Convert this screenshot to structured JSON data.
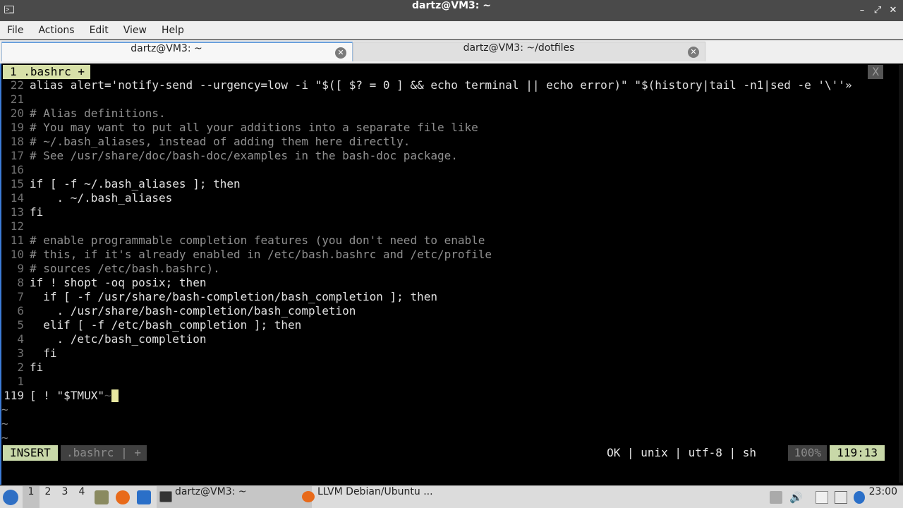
{
  "window": {
    "title": "dartz@VM3: ~"
  },
  "menu": [
    "File",
    "Actions",
    "Edit",
    "View",
    "Help"
  ],
  "tabs": [
    {
      "label": "dartz@VM3: ~",
      "active": true
    },
    {
      "label": "dartz@VM3: ~/dotfiles",
      "active": false
    }
  ],
  "vim": {
    "buffer_tab": "1 .bashrc +",
    "buffer_close": "X",
    "lines": [
      {
        "num": "22",
        "text": "alias alert='notify-send --urgency=low -i \"$([ $? = 0 ] && echo terminal || echo error)\" \"$(history|tail -n1|sed -e '\\''»",
        "kind": "code"
      },
      {
        "num": "21",
        "text": "",
        "kind": "code"
      },
      {
        "num": "20",
        "text": "# Alias definitions.",
        "kind": "comment"
      },
      {
        "num": "19",
        "text": "# You may want to put all your additions into a separate file like",
        "kind": "comment"
      },
      {
        "num": "18",
        "text": "# ~/.bash_aliases, instead of adding them here directly.",
        "kind": "comment"
      },
      {
        "num": "17",
        "text": "# See /usr/share/doc/bash-doc/examples in the bash-doc package.",
        "kind": "comment"
      },
      {
        "num": "16",
        "text": "",
        "kind": "code"
      },
      {
        "num": "15",
        "text": "if [ -f ~/.bash_aliases ]; then",
        "kind": "code"
      },
      {
        "num": "14",
        "text": "    . ~/.bash_aliases",
        "kind": "code"
      },
      {
        "num": "13",
        "text": "fi",
        "kind": "code"
      },
      {
        "num": "12",
        "text": "",
        "kind": "code"
      },
      {
        "num": "11",
        "text": "# enable programmable completion features (you don't need to enable",
        "kind": "comment"
      },
      {
        "num": "10",
        "text": "# this, if it's already enabled in /etc/bash.bashrc and /etc/profile",
        "kind": "comment"
      },
      {
        "num": "9",
        "text": "# sources /etc/bash.bashrc).",
        "kind": "comment"
      },
      {
        "num": "8",
        "text": "if ! shopt -oq posix; then",
        "kind": "code"
      },
      {
        "num": "7",
        "text": "  if [ -f /usr/share/bash-completion/bash_completion ]; then",
        "kind": "code"
      },
      {
        "num": "6",
        "text": "    . /usr/share/bash-completion/bash_completion",
        "kind": "code"
      },
      {
        "num": "5",
        "text": "  elif [ -f /etc/bash_completion ]; then",
        "kind": "code"
      },
      {
        "num": "4",
        "text": "    . /etc/bash_completion",
        "kind": "code"
      },
      {
        "num": "3",
        "text": "  fi",
        "kind": "code"
      },
      {
        "num": "2",
        "text": "fi",
        "kind": "code"
      },
      {
        "num": "1",
        "text": "",
        "kind": "code"
      }
    ],
    "current_line": {
      "num": "119",
      "text": "[ ! \"$TMUX\"",
      "ghost": "~"
    },
    "tildes": [
      "~",
      "~",
      "~"
    ],
    "status": {
      "mode": "INSERT",
      "file": ".bashrc | +",
      "right": "OK | unix | utf-8 | sh",
      "percent": "100%",
      "position": "119:13"
    }
  },
  "taskbar": {
    "workspaces": [
      "1",
      "2",
      "3",
      "4"
    ],
    "active_workspace": "1",
    "tasks": [
      {
        "label": "dartz@VM3: ~",
        "icon": "terminal-icon",
        "active": true
      },
      {
        "label": "LLVM Debian/Ubuntu ...",
        "icon": "firefox-icon",
        "active": false
      }
    ],
    "clock": "23:00"
  }
}
